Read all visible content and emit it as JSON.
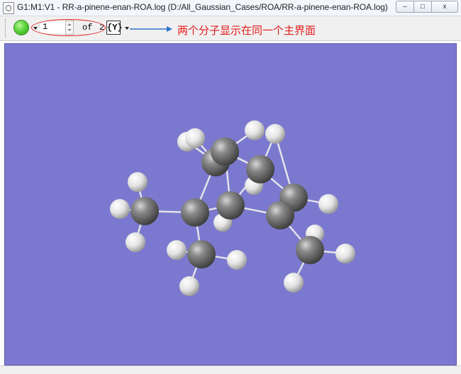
{
  "window": {
    "title": "G1:M1:V1 - RR-a-pinene-enan-ROA.log (D:/All_Gaussian_Cases/ROA/RR-a-pinene-enan-ROA.log)",
    "controls": {
      "minimize": "–",
      "maximize": "□",
      "close": "x"
    }
  },
  "toolbar": {
    "frame_value": "1",
    "of_label": "of",
    "total_frames": "2",
    "movie_button_label": "{Y}"
  },
  "annotation": {
    "text": "两个分子显示在同一个主界面",
    "color": "#e51c1c"
  },
  "viewport": {
    "background": "#7b79cf"
  },
  "molecule": {
    "atom_colors": {
      "carbon": "#6a6a6a",
      "hydrogen": "#e4e4e4",
      "bond": "#e8e8ea"
    }
  }
}
